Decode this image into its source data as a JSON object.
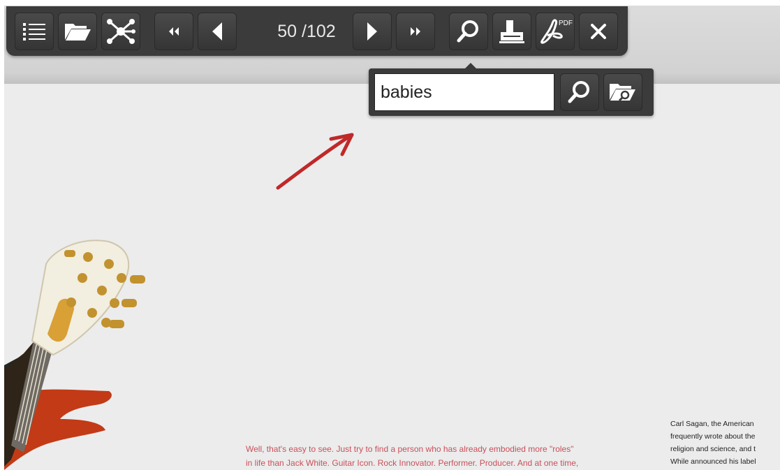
{
  "toolbar": {
    "buttons": [
      {
        "id": "contents",
        "icon": "list-icon"
      },
      {
        "id": "open",
        "icon": "folder-open-icon"
      },
      {
        "id": "share",
        "icon": "network-icon"
      },
      {
        "id": "first",
        "icon": "double-chevron-left-icon"
      },
      {
        "id": "previous",
        "icon": "triangle-left-icon"
      },
      {
        "id": "next",
        "icon": "triangle-right-icon"
      },
      {
        "id": "last",
        "icon": "double-chevron-right-icon"
      },
      {
        "id": "search",
        "icon": "search-icon"
      },
      {
        "id": "print",
        "icon": "printer-icon"
      },
      {
        "id": "pdf",
        "icon": "pdf-icon"
      },
      {
        "id": "close",
        "icon": "close-icon"
      }
    ],
    "page_counter": "50 /102",
    "pdf_label": "PDF"
  },
  "search": {
    "value": "babies",
    "search_button_icon": "search-icon",
    "search_folder_icon": "folder-search-icon"
  },
  "page": {
    "caption_red": [
      "Well, that's easy to see. Just try to find a person who has already embodied more \"roles\"",
      "in life than Jack White. Guitar Icon. Rock Innovator. Performer. Producer. And at one time,"
    ],
    "caption_black": [
      "Carl Sagan, the American",
      "frequently wrote about the",
      "religion and science, and t",
      "While announced his label"
    ]
  },
  "colors": {
    "toolbar_bg": "#3b3b3b",
    "annotation_arrow": "#c0282a",
    "caption_red": "#c8505a"
  }
}
